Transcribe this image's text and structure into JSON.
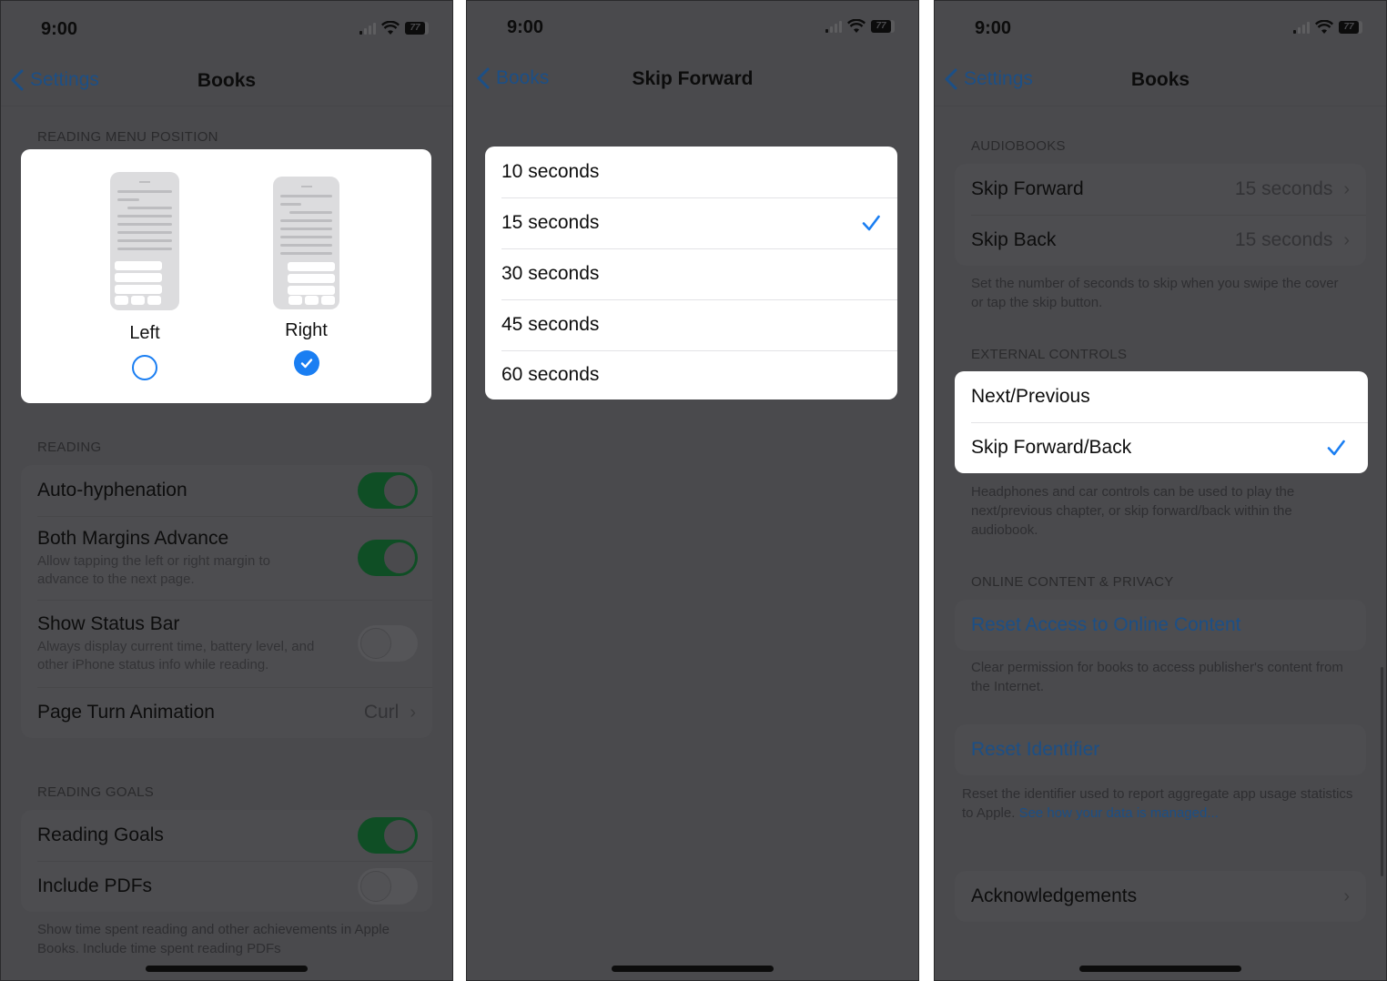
{
  "colors": {
    "accent_blue": "#1a7ef2",
    "toggle_on_dimmed": "#0f4e25",
    "dim_overlay_bg": "#4a4a4d",
    "card_white": "#ffffff"
  },
  "status_bar": {
    "time": "9:00",
    "battery": "77"
  },
  "panels": [
    {
      "nav": {
        "back_label": "Settings",
        "title": "Books"
      },
      "reading_menu_position": {
        "header": "READING MENU POSITION",
        "options": [
          {
            "label": "Left",
            "selected": false
          },
          {
            "label": "Right",
            "selected": true
          }
        ]
      },
      "reading": {
        "header": "READING",
        "rows": [
          {
            "label": "Auto-hyphenation",
            "toggle": true
          },
          {
            "label": "Both Margins Advance",
            "sub": "Allow tapping the left or right margin to advance to the next page.",
            "toggle": true
          },
          {
            "label": "Show Status Bar",
            "sub": "Always display current time, battery level, and other iPhone status info while reading.",
            "toggle": false
          },
          {
            "label": "Page Turn Animation",
            "value": "Curl"
          }
        ]
      },
      "reading_goals": {
        "header": "READING GOALS",
        "rows": [
          {
            "label": "Reading Goals",
            "toggle": true
          },
          {
            "label": "Include PDFs",
            "toggle": false
          }
        ],
        "footer": "Show time spent reading and other achievements in Apple Books. Include time spent reading PDFs"
      }
    },
    {
      "nav": {
        "back_label": "Books",
        "title": "Skip Forward"
      },
      "options": [
        {
          "label": "10 seconds",
          "selected": false
        },
        {
          "label": "15 seconds",
          "selected": true
        },
        {
          "label": "30 seconds",
          "selected": false
        },
        {
          "label": "45 seconds",
          "selected": false
        },
        {
          "label": "60 seconds",
          "selected": false
        }
      ]
    },
    {
      "nav": {
        "back_label": "Settings",
        "title": "Books"
      },
      "audiobooks": {
        "header": "AUDIOBOOKS",
        "rows": [
          {
            "label": "Skip Forward",
            "value": "15 seconds"
          },
          {
            "label": "Skip Back",
            "value": "15 seconds"
          }
        ],
        "footer": "Set the number of seconds to skip when you swipe the cover or tap the skip button."
      },
      "external_controls": {
        "header": "EXTERNAL CONTROLS",
        "options": [
          {
            "label": "Next/Previous",
            "selected": false
          },
          {
            "label": "Skip Forward/Back",
            "selected": true
          }
        ],
        "footer": "Headphones and car controls can be used to play the next/previous chapter, or skip forward/back within the audiobook."
      },
      "online_content": {
        "header": "ONLINE CONTENT & PRIVACY",
        "reset_access_label": "Reset Access to Online Content",
        "reset_access_footer": "Clear permission for books to access publisher's content from the Internet.",
        "reset_identifier_label": "Reset Identifier",
        "reset_identifier_footer": "Reset the identifier used to report aggregate app usage statistics to Apple.",
        "data_link": "See how your data is managed..."
      },
      "acknowledgements_label": "Acknowledgements"
    }
  ]
}
